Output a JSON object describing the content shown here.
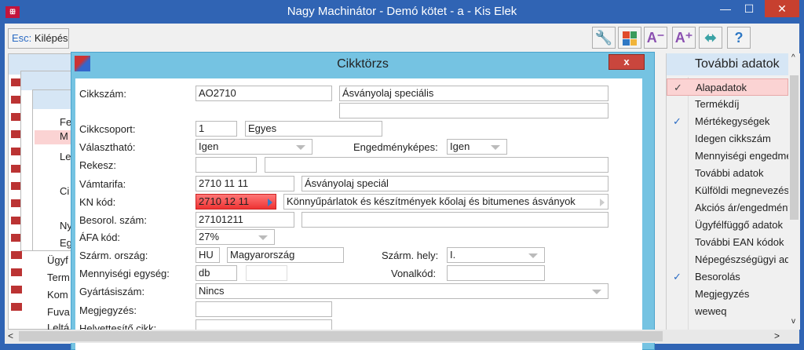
{
  "window": {
    "title": "Nagy Machinátor - Demó kötet - a - Kis Elek",
    "minimize": "—",
    "maximize": "☐",
    "close": "✕"
  },
  "toolbar": {
    "esc_key": "Esc:",
    "esc_label": "Kilépés",
    "buttons": [
      {
        "icon": "wrench-icon",
        "glyph": "🔧"
      },
      {
        "icon": "tiles-icon",
        "glyph": "▦"
      },
      {
        "icon": "font-decrease-icon",
        "glyph": "A⁻"
      },
      {
        "icon": "font-increase-icon",
        "glyph": "A⁺"
      },
      {
        "icon": "resize-horizontal-icon",
        "glyph": "⬌"
      },
      {
        "icon": "help-icon",
        "glyph": "?"
      }
    ]
  },
  "background": {
    "menu_items": [
      "Fe",
      "M",
      "Le",
      "Ci",
      "Ny",
      "Eg"
    ],
    "list_items": [
      "Ügyf",
      "Term",
      "Kom",
      "Fuva",
      "Leltá"
    ]
  },
  "dialog": {
    "title": "Cikktörzs",
    "close": "x"
  },
  "form": {
    "cikkszam": {
      "label": "Cikkszám:",
      "code": "AO2710",
      "name": "Ásványolaj speciális",
      "name2": ""
    },
    "cikkcsoport": {
      "label": "Cikkcsoport:",
      "code": "1",
      "name": "Egyes"
    },
    "valaszthato": {
      "label": "Választható:",
      "value": "Igen"
    },
    "engedmenykepes": {
      "label": "Engedményképes:",
      "value": "Igen"
    },
    "rekesz": {
      "label": "Rekesz:",
      "code": "",
      "name": ""
    },
    "vamtarifa": {
      "label": "Vámtarifa:",
      "code": "2710 11 11",
      "name": "Ásványolaj speciál"
    },
    "kn_kod": {
      "label": "KN kód:",
      "code": "2710 12 11",
      "name": "Könnyűpárlatok és készítmények kőolaj és bitumenes ásványok"
    },
    "besorol_szam": {
      "label": "Besorol. szám:",
      "code": "27101211",
      "name": ""
    },
    "afa_kod": {
      "label": "ÁFA kód:",
      "value": "27%"
    },
    "szarm_orszag": {
      "label": "Szárm. ország:",
      "code": "HU",
      "name": "Magyarország"
    },
    "szarm_hely": {
      "label": "Szárm. hely:",
      "value": "I."
    },
    "mennyisegi_egyseg": {
      "label": "Mennyiségi egység:",
      "code": "db",
      "name": ""
    },
    "vonalkod": {
      "label": "Vonalkód:",
      "value": ""
    },
    "gyartasiszam": {
      "label": "Gyártásiszám:",
      "value": "Nincs"
    },
    "megjegyzes": {
      "label": "Megjegyzés:",
      "value": ""
    },
    "helyettesito": {
      "label": "Helyettesítő cikk:",
      "value": ""
    }
  },
  "right_panel": {
    "title": "További adatok",
    "items": [
      {
        "label": "Alapadatok",
        "checked": true,
        "selected": true
      },
      {
        "label": "Termékdíj",
        "checked": false
      },
      {
        "label": "Mértékegységek",
        "checked": true
      },
      {
        "label": "Idegen cikkszám",
        "checked": false
      },
      {
        "label": "Mennyiségi engedmény",
        "checked": false
      },
      {
        "label": "További adatok",
        "checked": false
      },
      {
        "label": "Külföldi megnevezés",
        "checked": false
      },
      {
        "label": "Akciós ár/engedmény",
        "checked": false
      },
      {
        "label": "Ügyfélfüggő adatok",
        "checked": false
      },
      {
        "label": "További EAN kódok",
        "checked": false
      },
      {
        "label": "Népegészségügyi adó",
        "checked": false
      },
      {
        "label": "Besorolás",
        "checked": true
      },
      {
        "label": "Megjegyzés",
        "checked": false
      },
      {
        "label": "weweq",
        "checked": false
      }
    ],
    "check": "✓"
  },
  "scroll": {
    "left": "<",
    "right": ">",
    "up": "^",
    "down": "v"
  }
}
